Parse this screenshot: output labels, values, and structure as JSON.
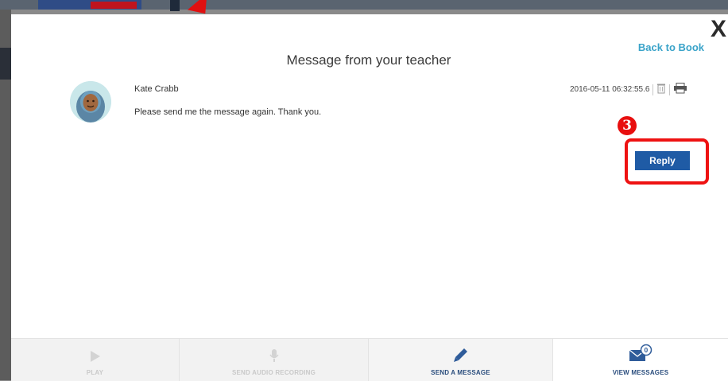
{
  "modal": {
    "title": "Message from your teacher",
    "back_link": "Back to Book",
    "close_label": "X"
  },
  "message": {
    "sender": "Kate Crabb",
    "body": "Please send me the message again. Thank you.",
    "timestamp": "2016-05-11 06:32:55.6"
  },
  "annotation": {
    "step_label": "3"
  },
  "reply_label": "Reply",
  "toolbar": {
    "play": "PLAY",
    "send_audio": "SEND AUDIO RECORDING",
    "send_message": "SEND A MESSAGE",
    "view_messages": "VIEW MESSAGES",
    "messages_count": "0"
  },
  "colors": {
    "accent_link": "#3aa3c9",
    "primary_button": "#1f5ba5",
    "annotation_red": "#ee1212",
    "toolbar_text": "#2a4d7d"
  },
  "icons": [
    "close-icon",
    "avatar-icon",
    "trash-icon",
    "print-icon",
    "play-icon",
    "microphone-icon",
    "pencil-icon",
    "envelope-icon"
  ]
}
